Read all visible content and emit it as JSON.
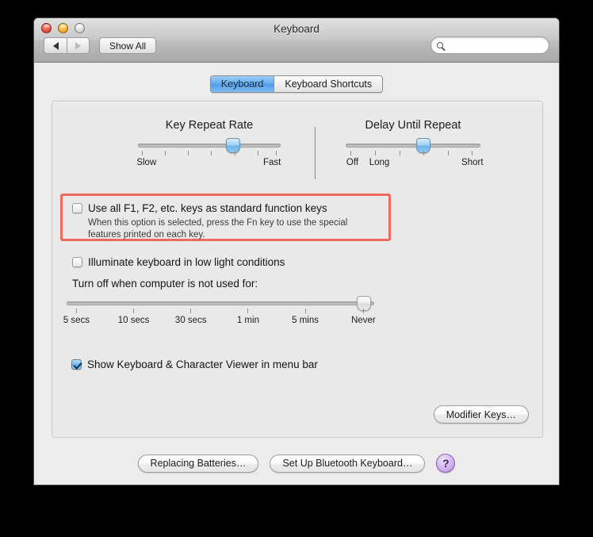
{
  "window": {
    "title": "Keyboard",
    "traffic_lights": [
      "close",
      "minimize",
      "zoom"
    ]
  },
  "toolbar": {
    "back_icon": "back-arrow-icon",
    "forward_icon": "forward-arrow-icon",
    "show_all_label": "Show All",
    "search_placeholder": "",
    "search_value": "",
    "search_icon": "search-icon"
  },
  "tabs": [
    {
      "label": "Keyboard",
      "active": true
    },
    {
      "label": "Keyboard Shortcuts",
      "active": false
    }
  ],
  "sliders": {
    "key_repeat": {
      "title": "Key Repeat Rate",
      "min_label": "Slow",
      "max_label": "Fast",
      "tick_count": 7,
      "value_index": 4,
      "enabled": true
    },
    "delay_until_repeat": {
      "title": "Delay Until Repeat",
      "labels": [
        "Off",
        "Long",
        "Short"
      ],
      "tick_count": 6,
      "value_index": 3,
      "enabled": true
    },
    "backlight_timeout": {
      "tick_labels": [
        "5 secs",
        "10 secs",
        "30 secs",
        "1 min",
        "5 mins",
        "Never"
      ],
      "tick_count": 6,
      "value_index": 5,
      "enabled": false
    }
  },
  "options": {
    "fn_keys": {
      "label": "Use all F1, F2, etc. keys as standard function keys",
      "checked": false,
      "note": "When this option is selected, press the Fn key to use the special features printed on each key.",
      "highlighted": true
    },
    "illuminate": {
      "label": "Illuminate keyboard in low light conditions",
      "checked": false
    },
    "turn_off_label": "Turn off when computer is not used for:",
    "show_viewer": {
      "label": "Show Keyboard & Character Viewer in menu bar",
      "checked": true
    }
  },
  "buttons": {
    "modifier_keys": "Modifier Keys…",
    "replacing_batteries": "Replacing Batteries…",
    "setup_bluetooth": "Set Up Bluetooth Keyboard…",
    "help": "?"
  },
  "colors": {
    "highlight": "#ef6a5a",
    "accent_blue": "#5fa9ee",
    "help_purple": "#c9a8e8",
    "window_bg": "#ececec"
  }
}
